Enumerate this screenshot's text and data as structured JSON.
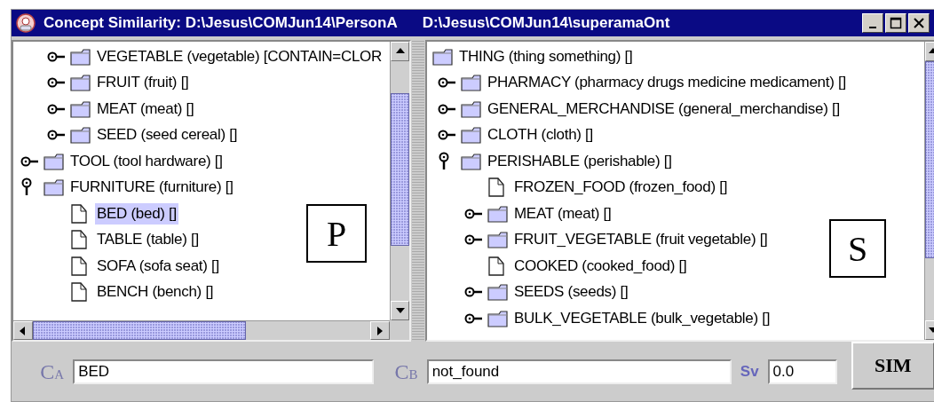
{
  "window": {
    "title": "Concept Similarity: D:\\Jesus\\COMJun14\\PersonA",
    "title_2": "D:\\Jesus\\COMJun14\\superamaOnt"
  },
  "left_tree": {
    "overlay_letter": "P",
    "items": [
      {
        "children": [
          {
            "kind": "folder",
            "label": "VEGETABLE (vegetable) [CONTAIN=CLOR",
            "expanded": false,
            "selected": false
          },
          {
            "kind": "folder",
            "label": "FRUIT (fruit) []",
            "expanded": false,
            "selected": false
          },
          {
            "kind": "folder",
            "label": "MEAT (meat) []",
            "expanded": false,
            "selected": false
          },
          {
            "kind": "folder",
            "label": "SEED (seed cereal) []",
            "expanded": false,
            "selected": false
          }
        ]
      },
      {
        "kind": "folder",
        "label": "TOOL (tool hardware) []",
        "expanded": false,
        "selected": false
      },
      {
        "kind": "folder",
        "label": "FURNITURE (furniture) []",
        "expanded": true,
        "selected": false,
        "children": [
          {
            "kind": "file",
            "label": "BED (bed) []",
            "selected": true
          },
          {
            "kind": "file",
            "label": "TABLE (table) []",
            "selected": false
          },
          {
            "kind": "file",
            "label": "SOFA (sofa seat) []",
            "selected": false
          },
          {
            "kind": "file",
            "label": "BENCH (bench) []",
            "selected": false
          }
        ]
      }
    ]
  },
  "right_tree": {
    "overlay_letter": "S",
    "items": [
      {
        "kind": "root_folder",
        "label": "THING (thing something) []",
        "selected": false,
        "children": [
          {
            "kind": "folder",
            "label": "PHARMACY (pharmacy drugs medicine medicament) []",
            "expanded": false,
            "selected": false
          },
          {
            "kind": "folder",
            "label": "GENERAL_MERCHANDISE (general_merchandise) []",
            "expanded": false,
            "selected": false
          },
          {
            "kind": "folder",
            "label": "CLOTH (cloth) []",
            "expanded": false,
            "selected": false
          },
          {
            "kind": "folder",
            "label": "PERISHABLE (perishable) []",
            "expanded": true,
            "selected": false,
            "children": [
              {
                "kind": "file",
                "label": "FROZEN_FOOD (frozen_food) []",
                "selected": false
              },
              {
                "kind": "folder",
                "label": "MEAT (meat) []",
                "expanded": false,
                "selected": false
              },
              {
                "kind": "folder",
                "label": "FRUIT_VEGETABLE (fruit vegetable) []",
                "expanded": false,
                "selected": false
              },
              {
                "kind": "file",
                "label": "COOKED (cooked_food) []",
                "selected": false
              },
              {
                "kind": "folder",
                "label": "SEEDS (seeds) []",
                "expanded": false,
                "selected": false
              },
              {
                "kind": "folder",
                "label": "BULK_VEGETABLE (bulk_vegetable) []",
                "expanded": false,
                "selected": false
              }
            ]
          }
        ]
      }
    ]
  },
  "bottom": {
    "ca_label": "C$_{A}$",
    "ca_value": "BED",
    "cb_label": "C$_{B}$",
    "cb_value": "not_found",
    "sv_label": "Sv",
    "sv_value": "0.0",
    "button": "SIM"
  }
}
